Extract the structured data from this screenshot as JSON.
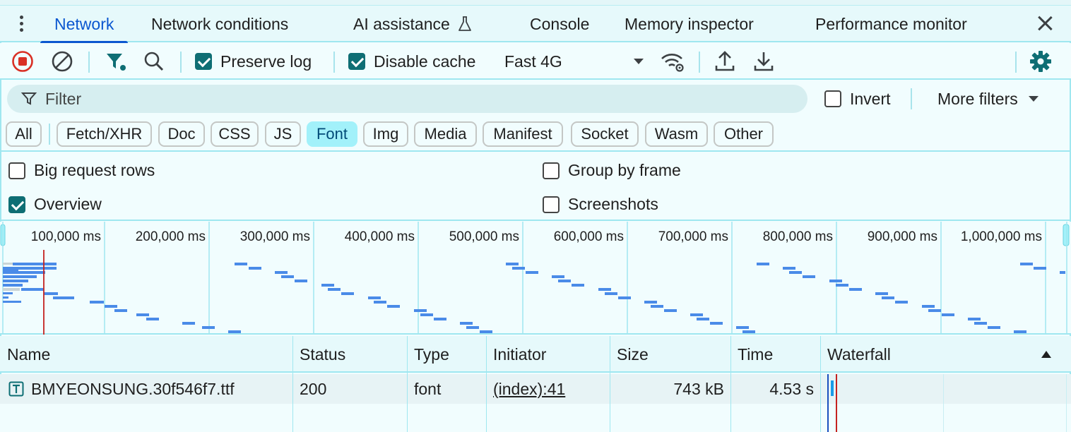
{
  "tabs": [
    {
      "label": "Network",
      "active": true
    },
    {
      "label": "Network conditions"
    },
    {
      "label": "AI assistance"
    },
    {
      "label": "Console"
    },
    {
      "label": "Memory inspector"
    },
    {
      "label": "Performance monitor"
    }
  ],
  "toolbar": {
    "preserve_log": "Preserve log",
    "disable_cache": "Disable cache",
    "throttle": "Fast 4G"
  },
  "filter": {
    "placeholder": "Filter",
    "invert": "Invert",
    "more_filters": "More filters"
  },
  "type_filters": [
    "All",
    "Fetch/XHR",
    "Doc",
    "CSS",
    "JS",
    "Font",
    "Img",
    "Media",
    "Manifest",
    "Socket",
    "Wasm",
    "Other"
  ],
  "type_filter_selected": "Font",
  "options": {
    "big_request_rows": {
      "label": "Big request rows",
      "checked": false
    },
    "group_by_frame": {
      "label": "Group by frame",
      "checked": false
    },
    "overview": {
      "label": "Overview",
      "checked": true
    },
    "screenshots": {
      "label": "Screenshots",
      "checked": false
    }
  },
  "overview": {
    "ticks": [
      "100,000 ms",
      "200,000 ms",
      "300,000 ms",
      "400,000 ms",
      "500,000 ms",
      "600,000 ms",
      "700,000 ms",
      "800,000 ms",
      "900,000 ms",
      "1,000,000 ms"
    ]
  },
  "table": {
    "columns": [
      "Name",
      "Status",
      "Type",
      "Initiator",
      "Size",
      "Time",
      "Waterfall"
    ],
    "rows": [
      {
        "name": "BMYEONSUNG.30f546f7.ttf",
        "status": "200",
        "type": "font",
        "initiator": "(index):41",
        "size": "743 kB",
        "time": "4.53 s"
      }
    ]
  },
  "colors": {
    "accent": "#0b57d0",
    "record_red": "#d93025",
    "selected_chip": "#a2f1fa",
    "bar_blue": "#4a8be8"
  }
}
